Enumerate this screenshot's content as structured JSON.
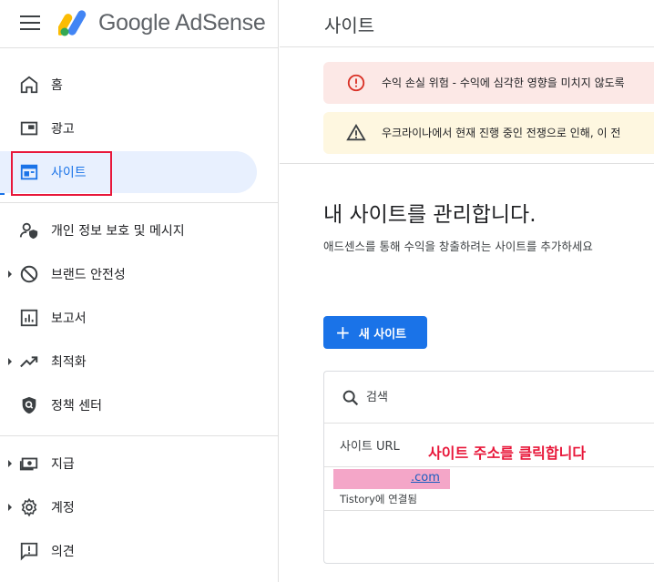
{
  "app": {
    "brand": "Google AdSense"
  },
  "sidebar": {
    "items": [
      {
        "label": "홈",
        "icon": "home-icon"
      },
      {
        "label": "광고",
        "icon": "ads-icon"
      },
      {
        "label": "사이트",
        "icon": "sites-icon",
        "active": true
      },
      {
        "label": "개인 정보 보호 및 메시지",
        "icon": "privacy-icon"
      },
      {
        "label": "브랜드 안전성",
        "icon": "block-icon"
      },
      {
        "label": "보고서",
        "icon": "reports-icon"
      },
      {
        "label": "최적화",
        "icon": "trending-icon"
      },
      {
        "label": "정책 센터",
        "icon": "policy-icon"
      },
      {
        "label": "지급",
        "icon": "payments-icon"
      },
      {
        "label": "계정",
        "icon": "gear-icon"
      },
      {
        "label": "의견",
        "icon": "feedback-icon"
      }
    ]
  },
  "header": {
    "title": "사이트"
  },
  "alerts": {
    "red": "수익 손실 위험 - 수익에 심각한 영향을 미치지 않도록",
    "yellow": "우크라이나에서 현재 진행 중인 전쟁으로 인해, 이 전"
  },
  "main": {
    "heading": "내 사이트를 관리합니다.",
    "subheading": "애드센스를 통해 수익을 창출하려는 사이트를 추가하세요",
    "new_site_label": "새 사이트",
    "search_placeholder": "검색",
    "column_header": "사이트 URL",
    "hint": "사이트 주소를 클릭합니다",
    "site": {
      "url_suffix": ".com",
      "status": "Tistory에 연결됨"
    }
  },
  "colors": {
    "accent": "#1a73e8",
    "active_bg": "#e8f0fe",
    "highlight_red": "#e8173a",
    "alert_red_bg": "#fce8e6",
    "alert_yellow_bg": "#fef7e0"
  }
}
